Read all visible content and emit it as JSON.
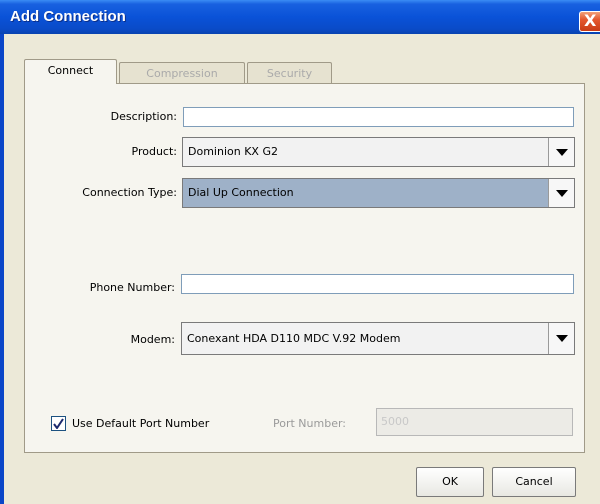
{
  "window": {
    "title": "Add Connection",
    "close_glyph": "X"
  },
  "tabs": [
    {
      "label": "Connect",
      "active": true
    },
    {
      "label": "Compression",
      "active": false
    },
    {
      "label": "Security",
      "active": false
    }
  ],
  "form": {
    "description": {
      "label": "Description:",
      "value": ""
    },
    "product": {
      "label": "Product:",
      "value": "Dominion KX G2"
    },
    "connection_type": {
      "label": "Connection Type:",
      "value": "Dial Up Connection"
    },
    "phone_number": {
      "label": "Phone Number:",
      "value": ""
    },
    "modem": {
      "label": "Modem:",
      "value": "Conexant HDA D110 MDC V.92 Modem"
    },
    "use_default_port": {
      "label": "Use Default Port Number",
      "checked": true
    },
    "port_number": {
      "label": "Port Number:",
      "value": "5000",
      "disabled": true
    }
  },
  "buttons": {
    "ok": "OK",
    "cancel": "Cancel"
  },
  "colors": {
    "titlebar": "#0a52d8",
    "selection": "#9eb1c8",
    "close": "#e4572e"
  }
}
